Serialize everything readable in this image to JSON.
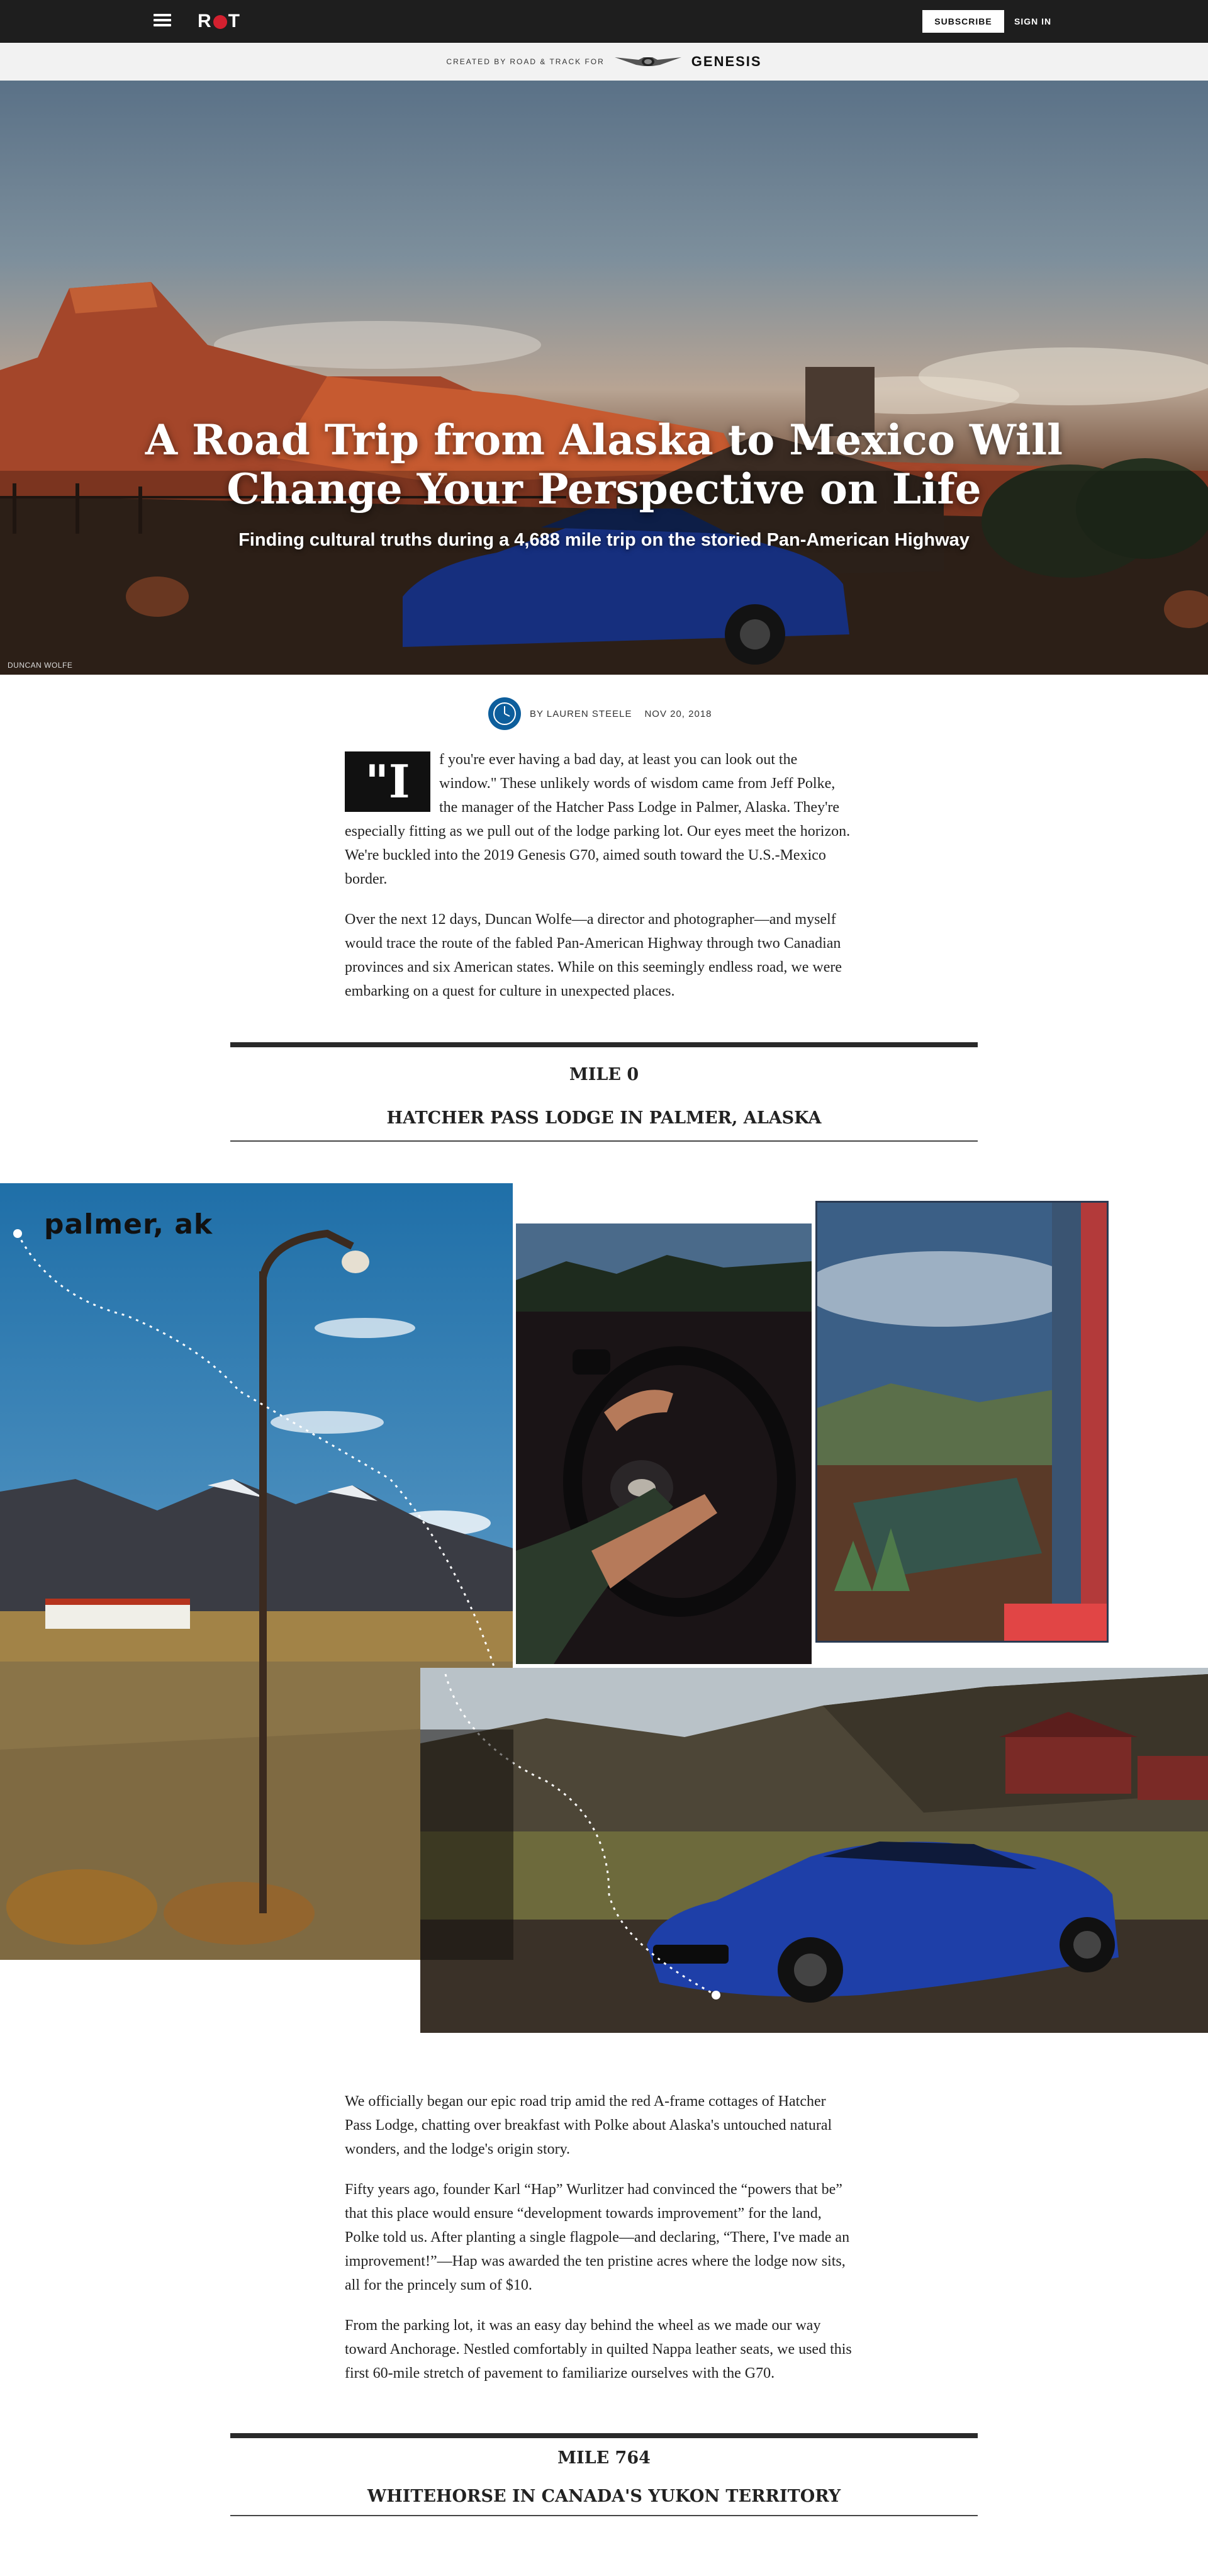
{
  "nav": {
    "logo_text": "R T",
    "subscribe_label": "SUBSCRIBE",
    "signin_label": "SIGN IN"
  },
  "sponsor": {
    "text": "CREATED BY ROAD & TRACK FOR",
    "brand": "GENESIS"
  },
  "hero": {
    "title": "A Road Trip from Alaska to Mexico Will Change Your Perspective on Life",
    "subtitle": "Finding cultural truths during a 4,688 mile trip on the storied Pan-American Highway",
    "credit": "DUNCAN WOLFE"
  },
  "byline": {
    "author": "BY LAUREN STEELE",
    "date": "NOV 20, 2018"
  },
  "intro": {
    "dropcap": "\"I",
    "p1": "f you're ever having a bad day, at least you can look out the window.\" These unlikely words of wisdom came from Jeff Polke, the manager of the Hatcher Pass Lodge in Palmer, Alaska. They're especially fitting as we pull out of the lodge parking lot. Our eyes meet the horizon. We're buckled into the 2019 Genesis G70, aimed south toward the U.S.-Mexico border.",
    "p2": "Over the next 12 days, Duncan Wolfe—a director and photographer—and myself would trace the route of the fabled Pan-American Highway through two Canadian provinces and six American states. While on this seemingly endless road, we were embarking on a quest for culture in unexpected places."
  },
  "section1": {
    "mile": "MILE 0",
    "place": "HATCHER PASS LODGE IN PALMER, ALASKA"
  },
  "collage": {
    "label": "palmer, ak"
  },
  "body2": {
    "p1": "We officially began our epic road trip amid the red A-frame cottages of Hatcher Pass Lodge, chatting over breakfast with Polke about Alaska's untouched natural wonders, and the lodge's origin story.",
    "p2": "Fifty years ago, founder Karl “Hap” Wurlitzer had convinced the “powers that be” that this place would ensure “development towards improvement” for the land, Polke told us. After planting a single flagpole—and declaring, “There, I've made an improvement!”—Hap was awarded the ten pristine acres where the lodge now sits, all for the princely sum of $10.",
    "p3": "From the parking lot, it was an easy day behind the wheel as we made our way toward Anchorage. Nestled comfortably in quilted Nappa leather seats, we used this first 60-mile stretch of pavement to familiarize ourselves with the G70."
  },
  "section2": {
    "mile": "MILE 764",
    "place": "WHITEHORSE IN CANADA'S YUKON TERRITORY"
  },
  "colors": {
    "nav_bg": "#1e1e1e",
    "sponsor_bg": "#f2f2f2",
    "logo_accent": "#d3202f",
    "avatar": "#0d5e9c",
    "car_blue": "#1e3fa8"
  }
}
